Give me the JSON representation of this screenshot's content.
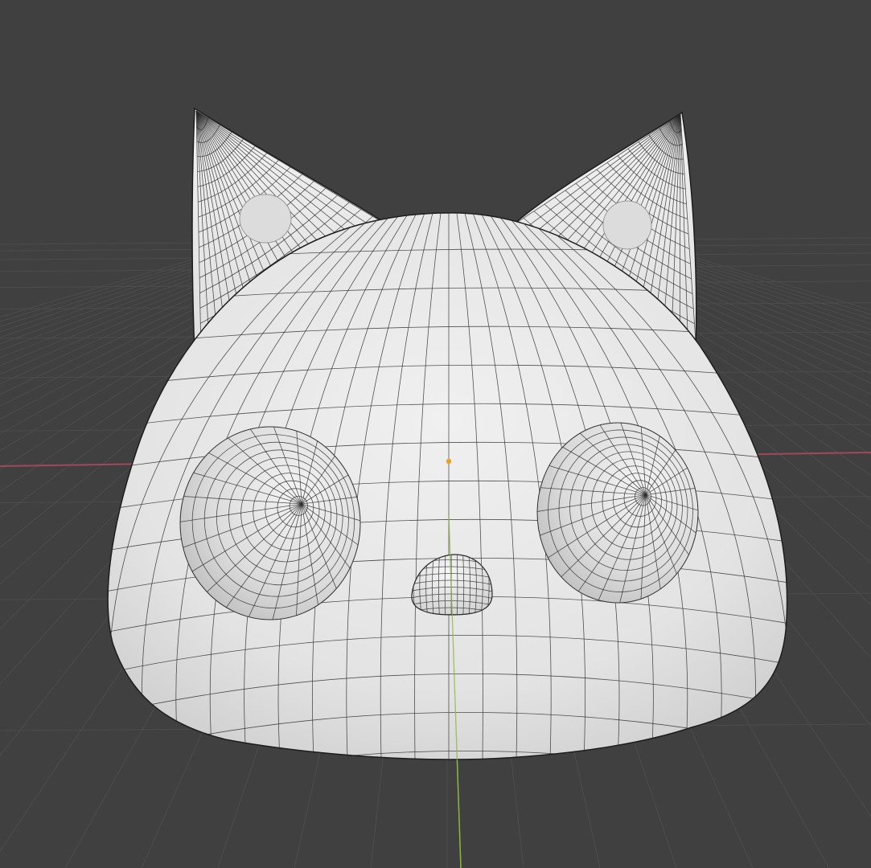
{
  "viewport": {
    "background_color": "#404040",
    "grid_color": "#4c4c4c",
    "x_axis_color": "#a1495a",
    "y_axis_color": "#8ab33a",
    "origin_color": "#e7a221"
  },
  "object": {
    "type": "cat-head-mesh",
    "display": "solid-with-wireframe",
    "surface_color": "#e9e9e9",
    "shadow_color": "#c8c8c8",
    "edge_color": "#2b2b2b"
  }
}
